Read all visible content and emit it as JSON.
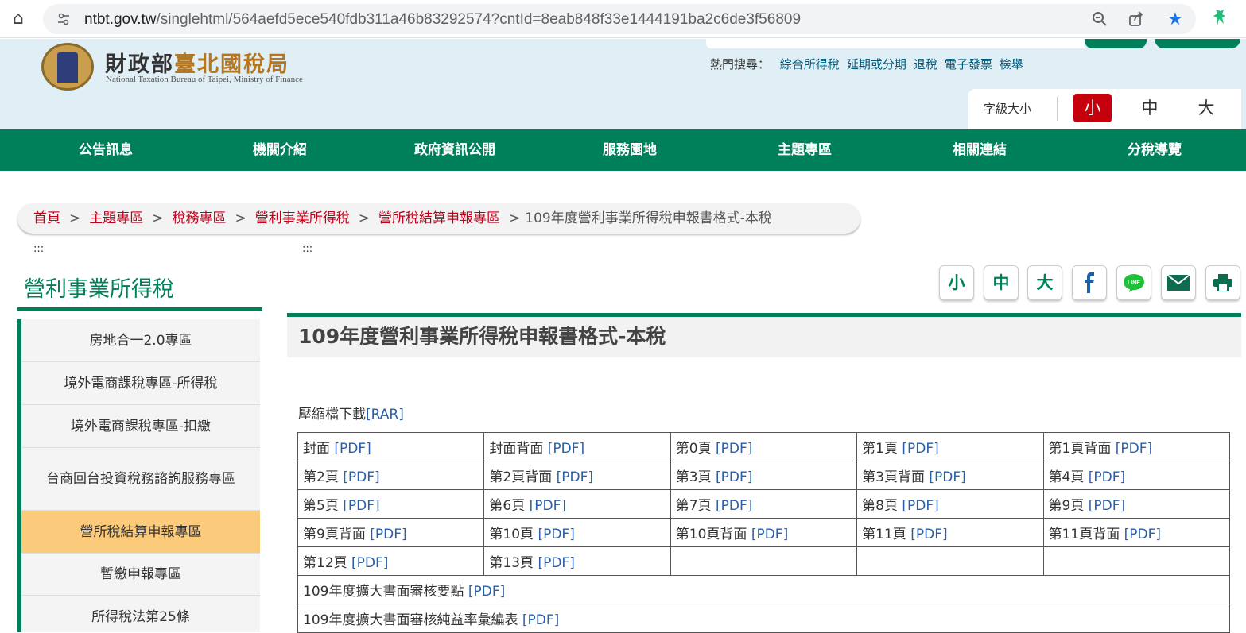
{
  "browser": {
    "url_host": "ntbt.gov.tw",
    "url_path": "/singlehtml/564aefd5ece540fdb311a46b83292574?cntId=8eab848f33e1444191ba2c6de3f56809"
  },
  "header": {
    "logo_cn_a": "財政部",
    "logo_cn_b": "臺北國稅局",
    "logo_en": "National Taxation Bureau of Taipei, Ministry of Finance",
    "hot_label": "熱門搜尋：",
    "hot_links": [
      "綜合所得稅",
      "延期或分期",
      "退稅",
      "電子發票",
      "檢舉"
    ],
    "font_size_label": "字級大小",
    "font_sizes": [
      "小",
      "中",
      "大"
    ]
  },
  "nav": [
    "公告訊息",
    "機關介紹",
    "政府資訊公開",
    "服務園地",
    "主題專區",
    "相關連結",
    "分稅導覽"
  ],
  "breadcrumb": {
    "items": [
      "首頁",
      "主題專區",
      "稅務專區",
      "營利事業所得稅",
      "營所稅結算申報專區"
    ],
    "current": "109年度營利事業所得稅申報書格式-本稅",
    "sep": ">"
  },
  "access_key": ":::",
  "sidebar": {
    "title": "營利事業所得稅",
    "items": [
      "房地合一2.0專區",
      "境外電商課稅專區-所得稅",
      "境外電商課稅專區-扣繳",
      "台商回台投資稅務諮詢服務專區",
      "營所稅結算申報專區",
      "暫繳申報專區",
      "所得稅法第25條"
    ]
  },
  "tools": {
    "small": "小",
    "medium": "中",
    "large": "大"
  },
  "content": {
    "title": "109年度營利事業所得稅申報書格式-本稅",
    "rar_label": "壓縮檔下載",
    "rar_link": "[RAR]",
    "pdf": "[PDF]",
    "grid": [
      [
        "封面",
        "封面背面",
        "第0頁",
        "第1頁",
        "第1頁背面"
      ],
      [
        "第2頁",
        "第2頁背面",
        "第3頁",
        "第3頁背面",
        "第4頁"
      ],
      [
        "第5頁",
        "第6頁",
        "第7頁",
        "第8頁",
        "第9頁"
      ],
      [
        "第9頁背面",
        "第10頁",
        "第10頁背面",
        "第11頁",
        "第11頁背面"
      ],
      [
        "第12頁",
        "第13頁",
        "",
        "",
        ""
      ]
    ],
    "extra_rows": [
      "109年度擴大書面審核要點",
      "109年度擴大書面審核純益率彙編表"
    ]
  }
}
